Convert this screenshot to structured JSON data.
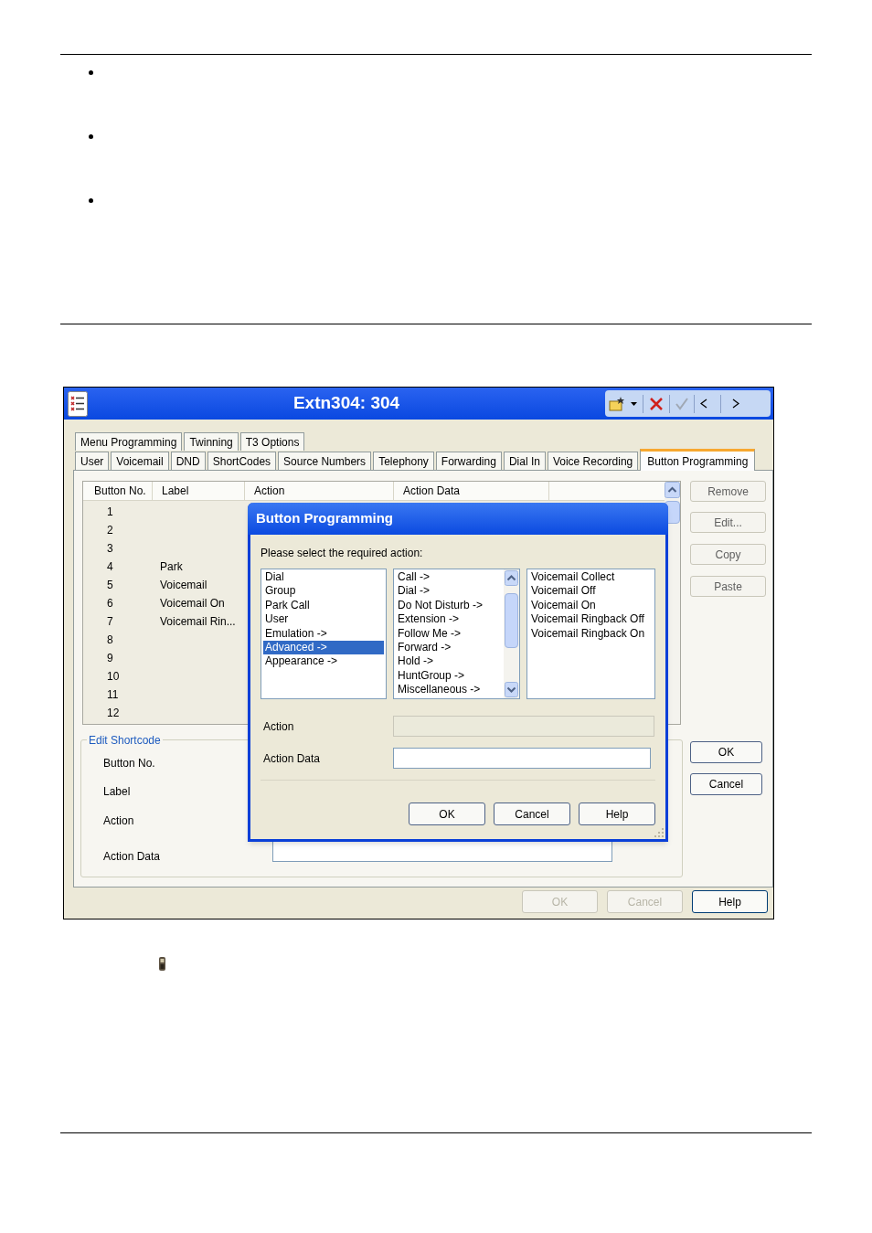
{
  "window": {
    "title": "Extn304: 304"
  },
  "tab_rows": [
    {
      "tabs": [
        {
          "label": "Menu Programming",
          "selected": false
        },
        {
          "label": "Twinning",
          "selected": false
        },
        {
          "label": "T3 Options",
          "selected": false
        }
      ]
    },
    {
      "tabs": [
        {
          "label": "User",
          "selected": false
        },
        {
          "label": "Voicemail",
          "selected": false
        },
        {
          "label": "DND",
          "selected": false
        },
        {
          "label": "ShortCodes",
          "selected": false
        },
        {
          "label": "Source Numbers",
          "selected": false
        },
        {
          "label": "Telephony",
          "selected": false
        },
        {
          "label": "Forwarding",
          "selected": false
        },
        {
          "label": "Dial In",
          "selected": false
        },
        {
          "label": "Voice Recording",
          "selected": false
        },
        {
          "label": "Button Programming",
          "selected": true
        }
      ]
    }
  ],
  "table": {
    "columns": [
      "Button No.",
      "Label",
      "Action",
      "Action Data"
    ],
    "rows": [
      {
        "button_no": "1"
      },
      {
        "button_no": "2"
      },
      {
        "button_no": "3"
      },
      {
        "button_no": "4",
        "label": "Park"
      },
      {
        "button_no": "5",
        "label": "Voicemail"
      },
      {
        "button_no": "6",
        "label": "Voicemail On"
      },
      {
        "button_no": "7",
        "label": "Voicemail Rin..."
      },
      {
        "button_no": "8"
      },
      {
        "button_no": "9"
      },
      {
        "button_no": "10"
      },
      {
        "button_no": "11"
      },
      {
        "button_no": "12"
      }
    ]
  },
  "side_buttons": [
    "Remove",
    "Edit...",
    "Copy",
    "Paste"
  ],
  "edit_shortcode": {
    "title": "Edit Shortcode",
    "fields": [
      "Button No.",
      "Label",
      "Action",
      "Action Data"
    ],
    "buttons": [
      "OK",
      "Cancel"
    ]
  },
  "footer_buttons": [
    {
      "label": "OK",
      "disabled": true
    },
    {
      "label": "Cancel",
      "disabled": true
    },
    {
      "label": "Help",
      "disabled": false
    }
  ],
  "dialog": {
    "title": "Button Programming",
    "prompt": "Please select the required action:",
    "lists": [
      {
        "items": [
          {
            "label": "Dial",
            "selected": false
          },
          {
            "label": "Group",
            "selected": false
          },
          {
            "label": "Park Call",
            "selected": false
          },
          {
            "label": "User",
            "selected": false
          },
          {
            "label": "Emulation ->",
            "selected": false
          },
          {
            "label": "Advanced ->",
            "selected": true
          },
          {
            "label": "Appearance ->",
            "selected": false
          }
        ]
      },
      {
        "scrollbar": true,
        "items": [
          {
            "label": "Call ->",
            "selected": false
          },
          {
            "label": "Dial ->",
            "selected": false
          },
          {
            "label": "Do Not Disturb ->",
            "selected": false
          },
          {
            "label": "Extension ->",
            "selected": false
          },
          {
            "label": "Follow Me ->",
            "selected": false
          },
          {
            "label": "Forward ->",
            "selected": false
          },
          {
            "label": "Hold ->",
            "selected": false
          },
          {
            "label": "HuntGroup ->",
            "selected": false
          },
          {
            "label": "Miscellaneous ->",
            "selected": false
          }
        ]
      },
      {
        "items": [
          {
            "label": "Voicemail Collect",
            "selected": false
          },
          {
            "label": "Voicemail Off",
            "selected": false
          },
          {
            "label": "Voicemail On",
            "selected": false
          },
          {
            "label": "Voicemail Ringback Off",
            "selected": false
          },
          {
            "label": "Voicemail Ringback On",
            "selected": false
          }
        ]
      }
    ],
    "fields": [
      {
        "label": "Action",
        "disabled": true
      },
      {
        "label": "Action Data",
        "disabled": false
      }
    ],
    "buttons": [
      "OK",
      "Cancel",
      "Help"
    ]
  }
}
